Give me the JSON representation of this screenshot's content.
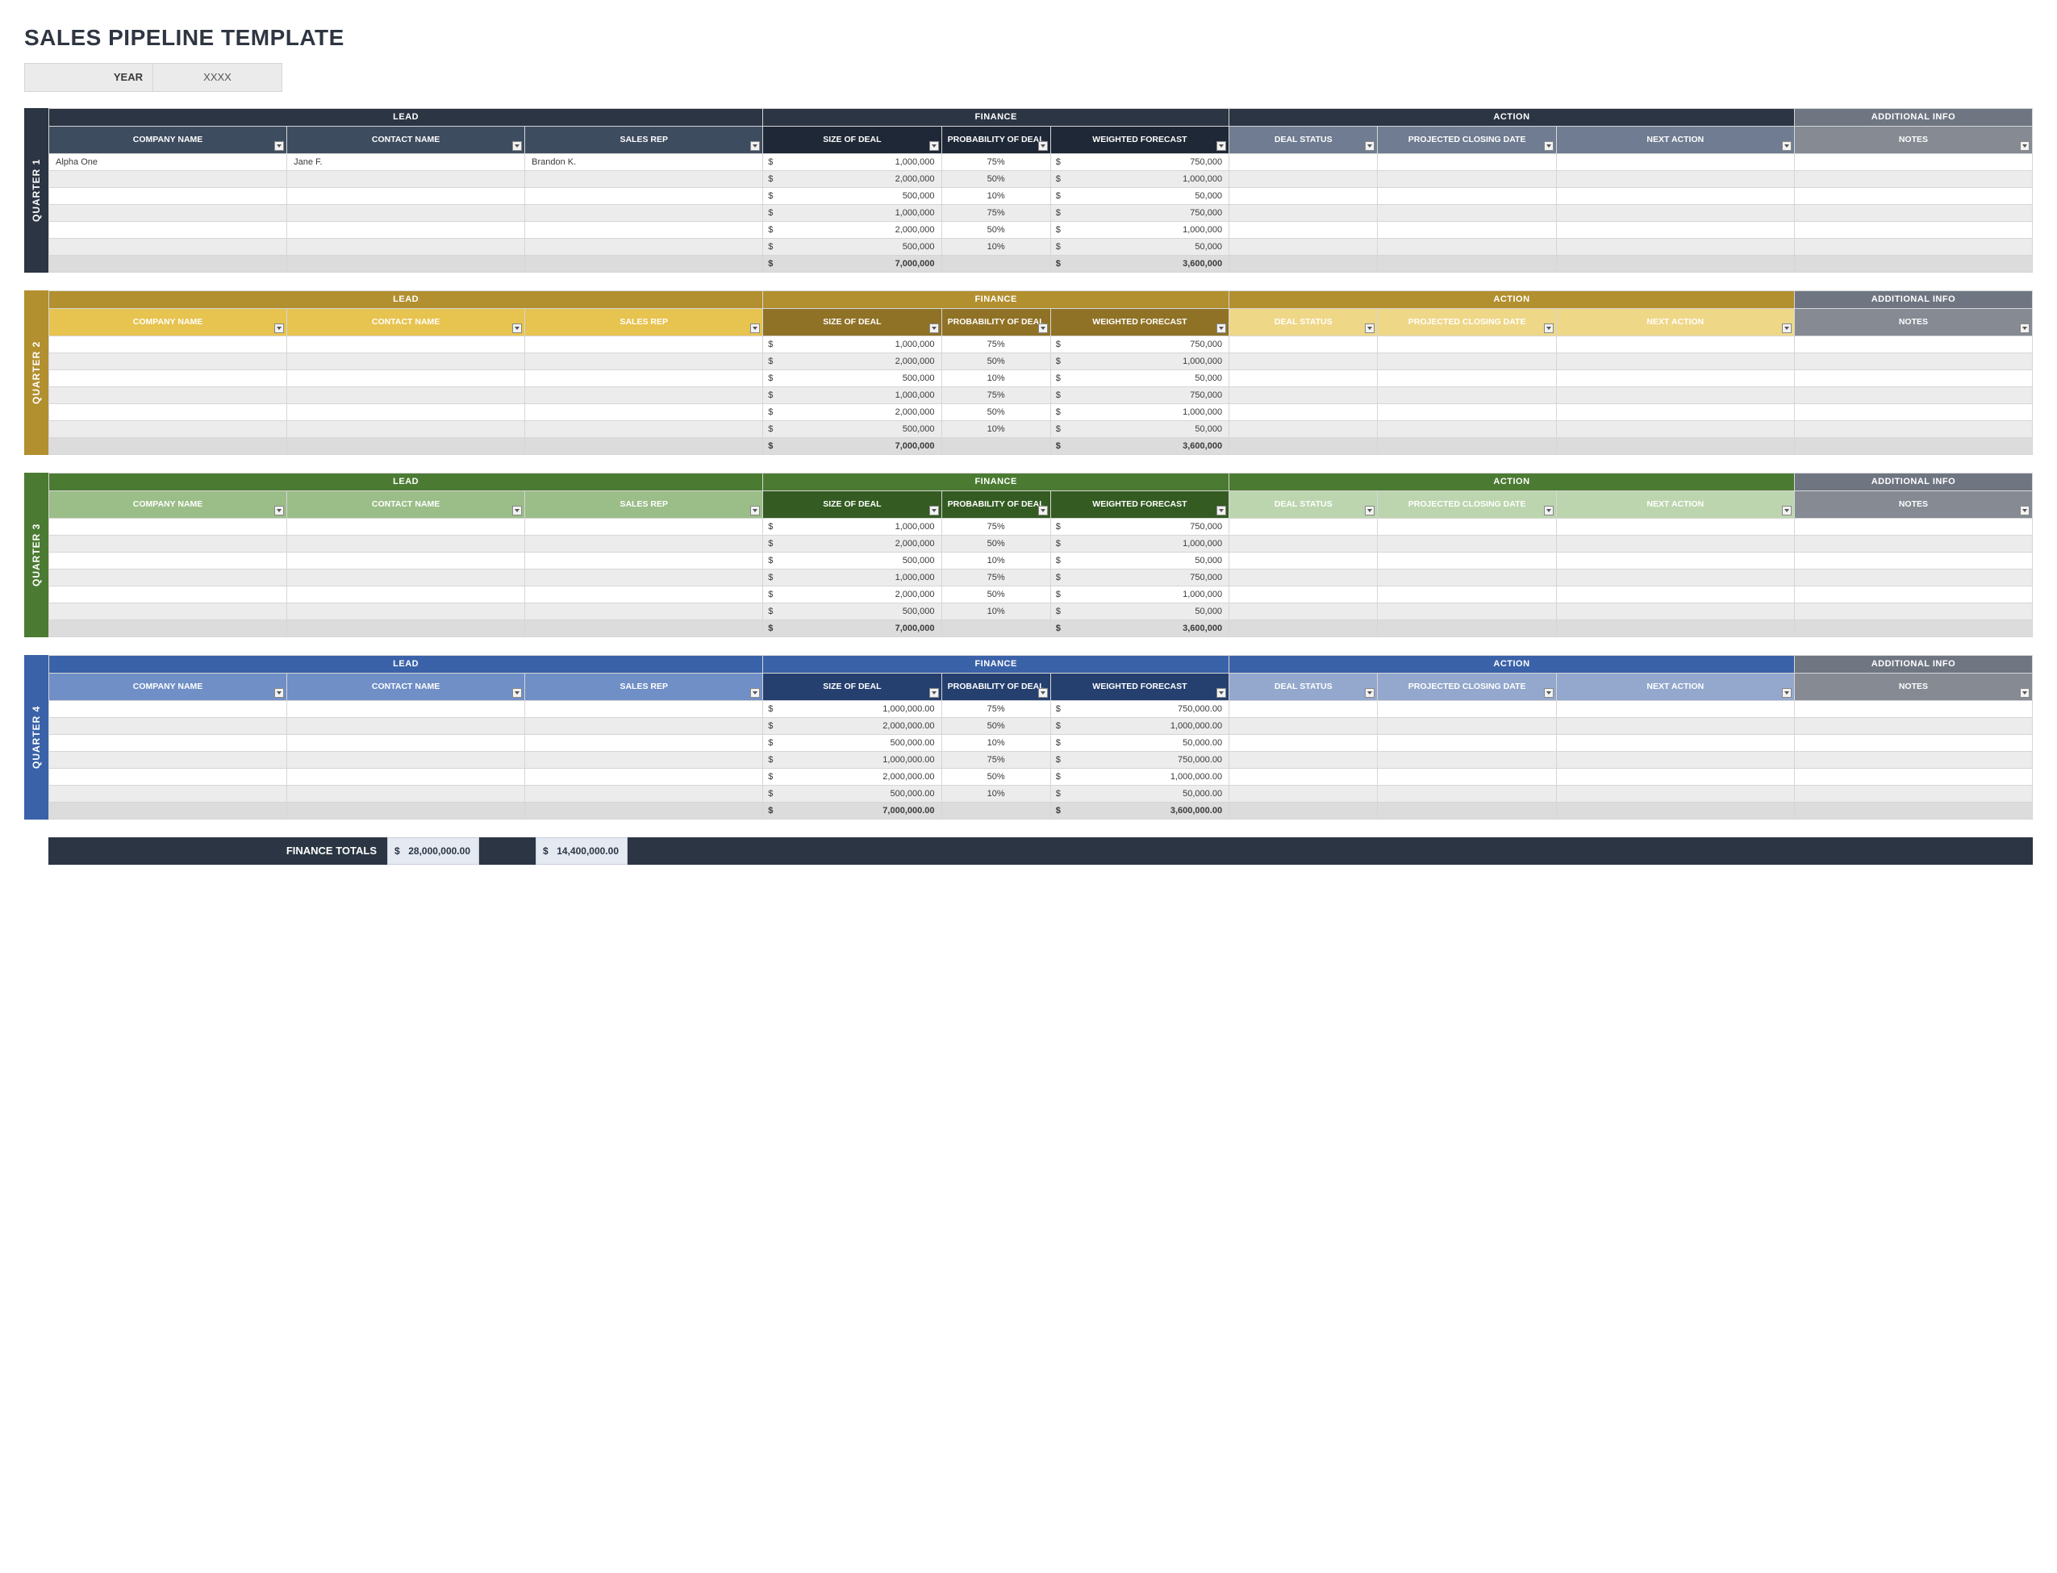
{
  "title": "SALES PIPELINE TEMPLATE",
  "year": {
    "label": "YEAR",
    "value": "XXXX"
  },
  "groupHeaders": {
    "lead": "LEAD",
    "finance": "FINANCE",
    "action": "ACTION",
    "info": "ADDITIONAL INFO"
  },
  "subHeaders": {
    "company": "COMPANY NAME",
    "contact": "CONTACT NAME",
    "rep": "SALES REP",
    "size": "SIZE OF DEAL",
    "prob": "PROBABILITY OF DEAL",
    "wf": "WEIGHTED FORECAST",
    "status": "DEAL STATUS",
    "close": "PROJECTED CLOSING DATE",
    "next": "NEXT ACTION",
    "notes": "NOTES"
  },
  "financeTotals": {
    "label": "FINANCE TOTALS",
    "size": "28,000,000.00",
    "wf": "14,400,000.00"
  },
  "quarters": [
    {
      "id": "q1",
      "label": "QUARTER 1",
      "colors": {
        "side": "#2b3543",
        "grpLead": "#2b3543",
        "grpFin": "#2b3543",
        "grpAct": "#2b3543",
        "grpInfo": "#6f7682",
        "subLead": "#3e4c60",
        "subFin": "#1e2836",
        "subAct": "#6f7c91",
        "subInfo": "#858a93"
      },
      "rows": [
        {
          "company": "Alpha One",
          "contact": "Jane F.",
          "rep": "Brandon K.",
          "size": "1,000,000",
          "prob": "75%",
          "wf": "750,000"
        },
        {
          "company": "",
          "contact": "",
          "rep": "",
          "size": "2,000,000",
          "prob": "50%",
          "wf": "1,000,000"
        },
        {
          "company": "",
          "contact": "",
          "rep": "",
          "size": "500,000",
          "prob": "10%",
          "wf": "50,000"
        },
        {
          "company": "",
          "contact": "",
          "rep": "",
          "size": "1,000,000",
          "prob": "75%",
          "wf": "750,000"
        },
        {
          "company": "",
          "contact": "",
          "rep": "",
          "size": "2,000,000",
          "prob": "50%",
          "wf": "1,000,000"
        },
        {
          "company": "",
          "contact": "",
          "rep": "",
          "size": "500,000",
          "prob": "10%",
          "wf": "50,000"
        }
      ],
      "total": {
        "size": "7,000,000",
        "wf": "3,600,000"
      }
    },
    {
      "id": "q2",
      "label": "QUARTER 2",
      "colors": {
        "side": "#b28f2f",
        "grpLead": "#b28f2f",
        "grpFin": "#b28f2f",
        "grpAct": "#b28f2f",
        "grpInfo": "#6f7682",
        "subLead": "#e7c34f",
        "subFin": "#8f7226",
        "subAct": "#efd788",
        "subInfo": "#858a93"
      },
      "rows": [
        {
          "company": "",
          "contact": "",
          "rep": "",
          "size": "1,000,000",
          "prob": "75%",
          "wf": "750,000"
        },
        {
          "company": "",
          "contact": "",
          "rep": "",
          "size": "2,000,000",
          "prob": "50%",
          "wf": "1,000,000"
        },
        {
          "company": "",
          "contact": "",
          "rep": "",
          "size": "500,000",
          "prob": "10%",
          "wf": "50,000"
        },
        {
          "company": "",
          "contact": "",
          "rep": "",
          "size": "1,000,000",
          "prob": "75%",
          "wf": "750,000"
        },
        {
          "company": "",
          "contact": "",
          "rep": "",
          "size": "2,000,000",
          "prob": "50%",
          "wf": "1,000,000"
        },
        {
          "company": "",
          "contact": "",
          "rep": "",
          "size": "500,000",
          "prob": "10%",
          "wf": "50,000"
        }
      ],
      "total": {
        "size": "7,000,000",
        "wf": "3,600,000"
      }
    },
    {
      "id": "q3",
      "label": "QUARTER 3",
      "colors": {
        "side": "#4b7b32",
        "grpLead": "#4b7b32",
        "grpFin": "#4b7b32",
        "grpAct": "#4b7b32",
        "grpInfo": "#6f7682",
        "subLead": "#9bbd88",
        "subFin": "#345b22",
        "subAct": "#bcd5ae",
        "subInfo": "#858a93"
      },
      "rows": [
        {
          "company": "",
          "contact": "",
          "rep": "",
          "size": "1,000,000",
          "prob": "75%",
          "wf": "750,000"
        },
        {
          "company": "",
          "contact": "",
          "rep": "",
          "size": "2,000,000",
          "prob": "50%",
          "wf": "1,000,000"
        },
        {
          "company": "",
          "contact": "",
          "rep": "",
          "size": "500,000",
          "prob": "10%",
          "wf": "50,000"
        },
        {
          "company": "",
          "contact": "",
          "rep": "",
          "size": "1,000,000",
          "prob": "75%",
          "wf": "750,000"
        },
        {
          "company": "",
          "contact": "",
          "rep": "",
          "size": "2,000,000",
          "prob": "50%",
          "wf": "1,000,000"
        },
        {
          "company": "",
          "contact": "",
          "rep": "",
          "size": "500,000",
          "prob": "10%",
          "wf": "50,000"
        }
      ],
      "total": {
        "size": "7,000,000",
        "wf": "3,600,000"
      }
    },
    {
      "id": "q4",
      "label": "QUARTER 4",
      "colors": {
        "side": "#3a62a8",
        "grpLead": "#3a62a8",
        "grpFin": "#3a62a8",
        "grpAct": "#3a62a8",
        "grpInfo": "#6f7682",
        "subLead": "#6f8fc6",
        "subFin": "#25406f",
        "subAct": "#93a8cc",
        "subInfo": "#858a93"
      },
      "rows": [
        {
          "company": "",
          "contact": "",
          "rep": "",
          "size": "1,000,000.00",
          "prob": "75%",
          "wf": "750,000.00"
        },
        {
          "company": "",
          "contact": "",
          "rep": "",
          "size": "2,000,000.00",
          "prob": "50%",
          "wf": "1,000,000.00"
        },
        {
          "company": "",
          "contact": "",
          "rep": "",
          "size": "500,000.00",
          "prob": "10%",
          "wf": "50,000.00"
        },
        {
          "company": "",
          "contact": "",
          "rep": "",
          "size": "1,000,000.00",
          "prob": "75%",
          "wf": "750,000.00"
        },
        {
          "company": "",
          "contact": "",
          "rep": "",
          "size": "2,000,000.00",
          "prob": "50%",
          "wf": "1,000,000.00"
        },
        {
          "company": "",
          "contact": "",
          "rep": "",
          "size": "500,000.00",
          "prob": "10%",
          "wf": "50,000.00"
        }
      ],
      "total": {
        "size": "7,000,000.00",
        "wf": "3,600,000.00"
      }
    }
  ]
}
